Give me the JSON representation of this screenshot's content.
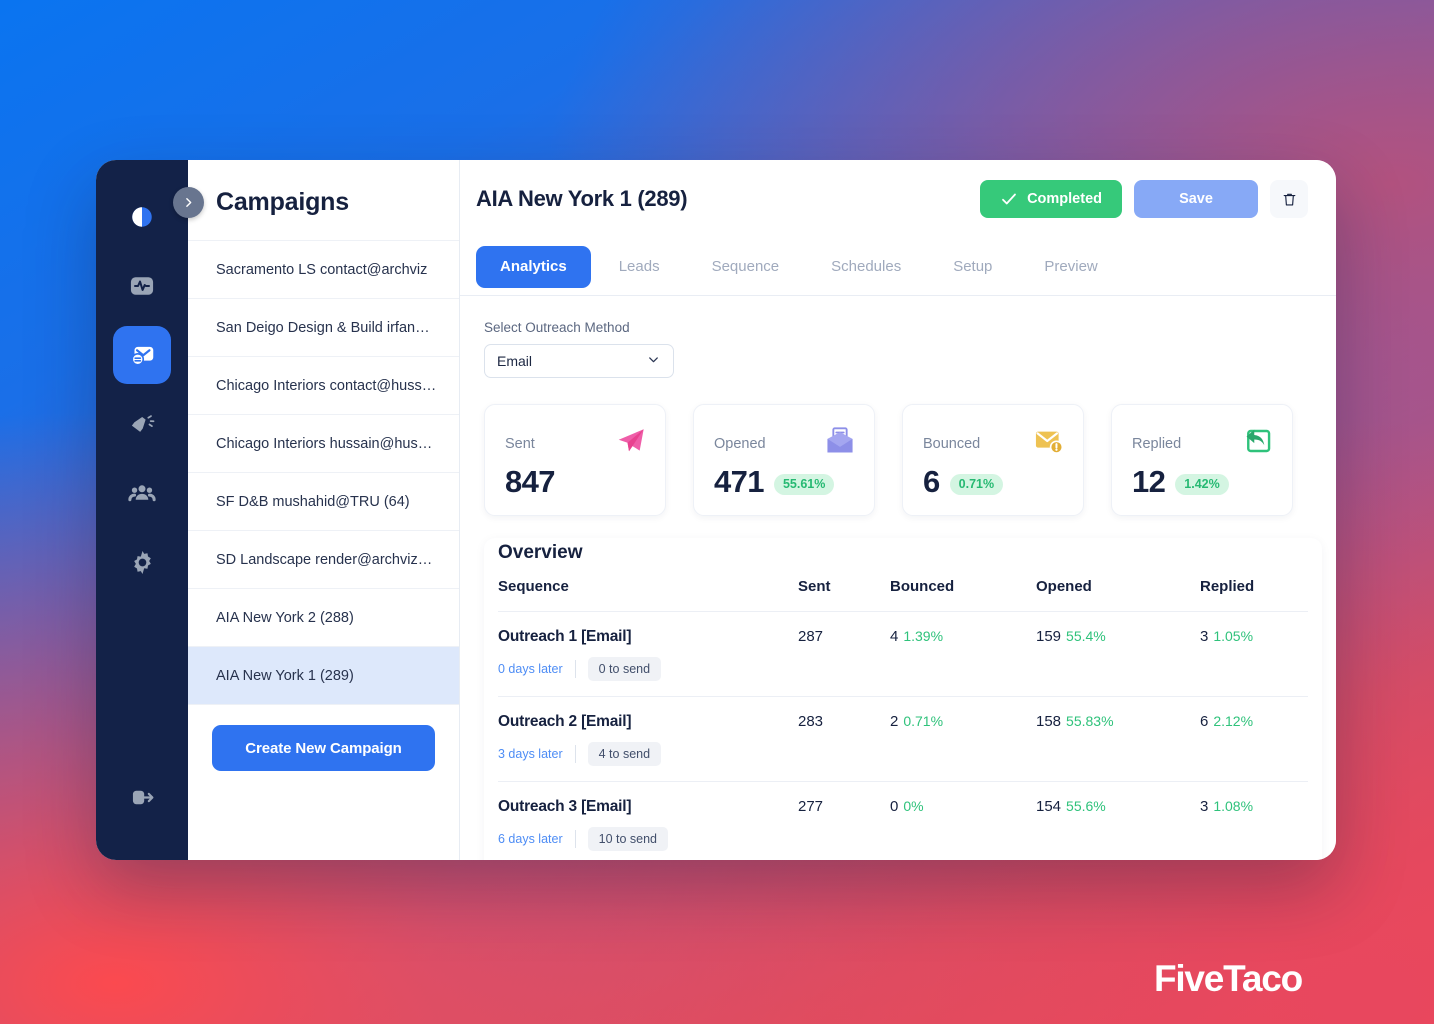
{
  "brand": {
    "name": "FiveTaco"
  },
  "rail": {
    "items": [
      {
        "name": "theme-toggle",
        "icon": "half-moon-icon"
      },
      {
        "name": "activity",
        "icon": "pulse-icon"
      },
      {
        "name": "campaigns",
        "icon": "mail-user-icon"
      },
      {
        "name": "marketing",
        "icon": "megaphone-icon"
      },
      {
        "name": "contacts",
        "icon": "people-icon"
      },
      {
        "name": "settings",
        "icon": "gear-icon"
      },
      {
        "name": "logout",
        "icon": "logout-icon"
      }
    ],
    "collapse_icon": "chevron-right-icon"
  },
  "sidebar": {
    "title": "Campaigns",
    "items": [
      {
        "label": "Sacramento LS contact@archviz"
      },
      {
        "label": "San Deigo Design & Build irfan@…"
      },
      {
        "label": "Chicago Interiors contact@huss…"
      },
      {
        "label": "Chicago Interiors hussain@huss…"
      },
      {
        "label": "SF D&B mushahid@TRU (64)"
      },
      {
        "label": "SD Landscape render@archvizal…"
      },
      {
        "label": "AIA New York 2 (288)"
      },
      {
        "label": "AIA New York 1 (289)"
      }
    ],
    "selected_index": 7,
    "create_button": "Create New Campaign"
  },
  "header": {
    "title": "AIA New York 1 (289)",
    "completed_label": "Completed",
    "save_label": "Save",
    "delete_icon": "trash-icon",
    "check_icon": "check-icon"
  },
  "tabs": [
    {
      "label": "Analytics",
      "active": true
    },
    {
      "label": "Leads",
      "active": false
    },
    {
      "label": "Sequence",
      "active": false
    },
    {
      "label": "Schedules",
      "active": false
    },
    {
      "label": "Setup",
      "active": false
    },
    {
      "label": "Preview",
      "active": false
    }
  ],
  "outreach": {
    "label": "Select Outreach Method",
    "selected": "Email",
    "options": [
      "Email"
    ],
    "chevron_icon": "chevron-down-icon"
  },
  "stats": [
    {
      "label": "Sent",
      "value": "847",
      "pct": "",
      "icon": "paper-plane-icon",
      "color": "#ef5da8"
    },
    {
      "label": "Opened",
      "value": "471",
      "pct": "55.61%",
      "icon": "open-envelope-icon",
      "color": "#8d8fe8"
    },
    {
      "label": "Bounced",
      "value": "6",
      "pct": "0.71%",
      "icon": "envelope-alert-icon",
      "color": "#eec252"
    },
    {
      "label": "Replied",
      "value": "12",
      "pct": "1.42%",
      "icon": "reply-arrow-icon",
      "color": "#2fc27b"
    }
  ],
  "overview": {
    "title": "Overview",
    "columns": [
      "Sequence",
      "Sent",
      "Bounced",
      "Opened",
      "Replied"
    ],
    "rows": [
      {
        "sequence": "Outreach 1 [Email]",
        "days_later": "0 days later",
        "to_send": "0 to send",
        "sent": "287",
        "bounced": "4",
        "bounced_pct": "1.39%",
        "opened": "159",
        "opened_pct": "55.4%",
        "replied": "3",
        "replied_pct": "1.05%"
      },
      {
        "sequence": "Outreach 2 [Email]",
        "days_later": "3 days later",
        "to_send": "4 to send",
        "sent": "283",
        "bounced": "2",
        "bounced_pct": "0.71%",
        "opened": "158",
        "opened_pct": "55.83%",
        "replied": "6",
        "replied_pct": "2.12%"
      },
      {
        "sequence": "Outreach 3 [Email]",
        "days_later": "6 days later",
        "to_send": "10 to send",
        "sent": "277",
        "bounced": "0",
        "bounced_pct": "0%",
        "opened": "154",
        "opened_pct": "55.6%",
        "replied": "3",
        "replied_pct": "1.08%"
      }
    ]
  },
  "colors": {
    "accent_blue": "#2f73f0",
    "navy": "#132248",
    "green": "#36c97a",
    "save_blue": "#87a9f6",
    "pill_green_bg": "#d4f5e2",
    "pill_green_text": "#26b972"
  }
}
